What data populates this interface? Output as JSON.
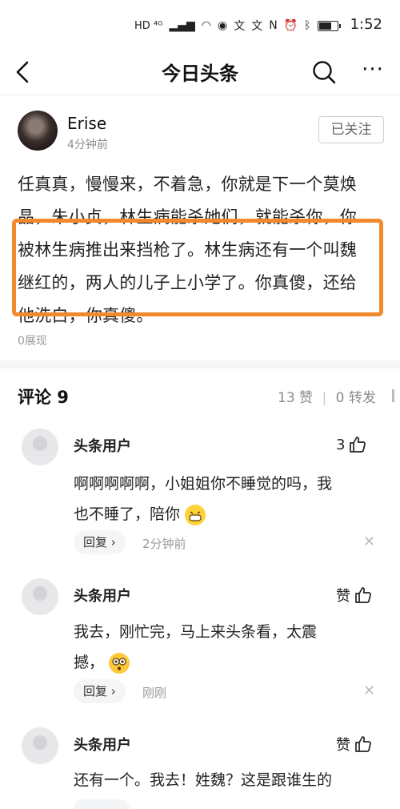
{
  "status_bar": {
    "left_indicators": "HD ⁴ᴳ",
    "time": "1:52",
    "battery_level": 0.7
  },
  "nav": {
    "title": "今日头条"
  },
  "author": {
    "name": "Erise",
    "time": "4分钟前",
    "follow_label": "已关注"
  },
  "post": {
    "lines": [
      "任真真，慢慢来，不着急，你就是下一个莫焕",
      "晶，朱小贞，林生病能杀她们，就能杀你，你",
      "被林生病推出来挡枪了。林生病还有一个叫魏",
      "继红的，两人的儿子上小学了。你真傻，还给",
      "他洗白，你真傻。"
    ],
    "views": "0展现"
  },
  "comments_header": {
    "title": "评论 9",
    "likes": "13 赞",
    "separator": "|",
    "shares": "0 转发"
  },
  "comments": [
    {
      "user": "头条用户",
      "likes": "3",
      "lines": [
        "啊啊啊啊啊，小姐姐你不睡觉的吗，我",
        "也不睡了，陪你"
      ],
      "reply_label": "回复 ›",
      "time": "2分钟前"
    },
    {
      "user": "头条用户",
      "likes": "赞",
      "lines": [
        "我去，刚忙完，马上来头条看，太震",
        "撼，"
      ],
      "reply_label": "回复 ›",
      "time": "刚刚"
    },
    {
      "user": "头条用户",
      "likes": "赞",
      "lines": [
        "还有一个。我去！姓魏？这是跟谁生的"
      ]
    }
  ]
}
